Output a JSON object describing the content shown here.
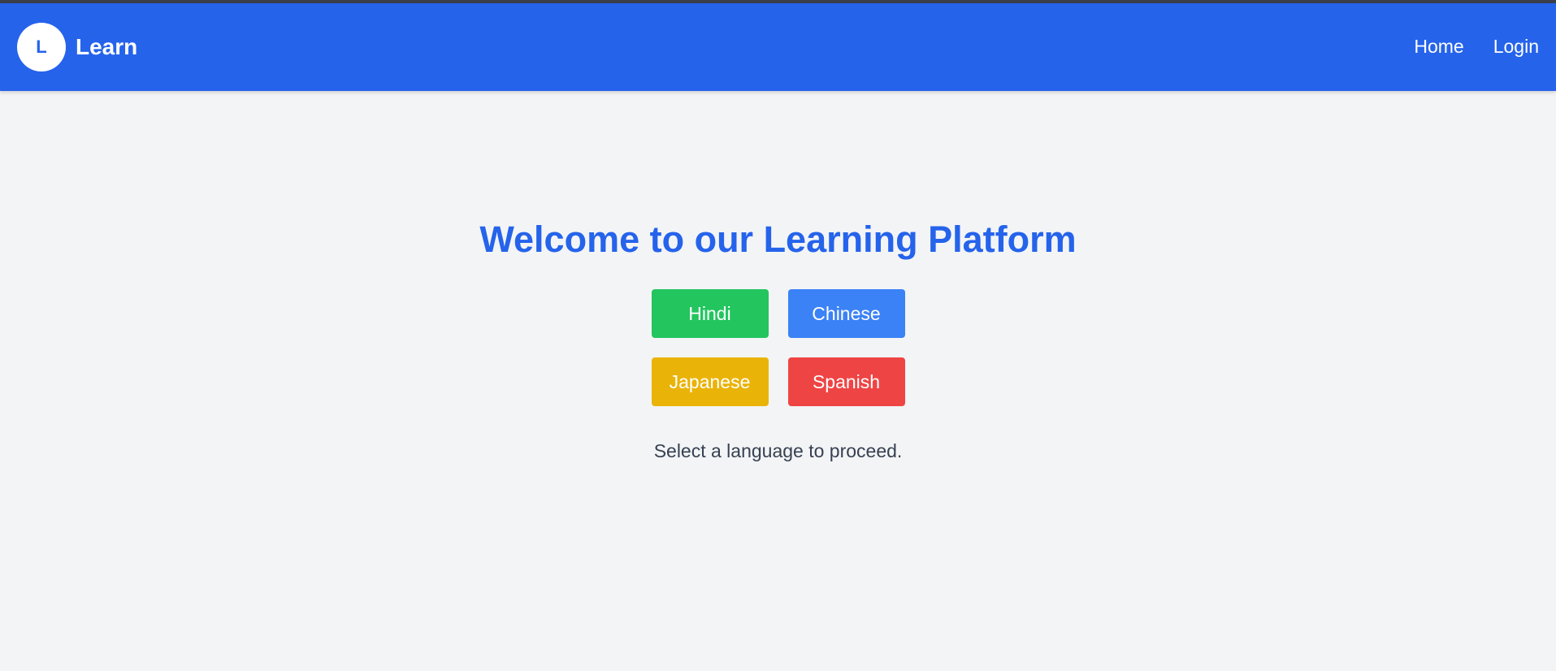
{
  "header": {
    "logo_letter": "L",
    "brand_name": "Learn",
    "nav": [
      {
        "label": "Home"
      },
      {
        "label": "Login"
      }
    ]
  },
  "main": {
    "title": "Welcome to our Learning Platform",
    "languages": [
      {
        "label": "Hindi",
        "color": "#22c55e"
      },
      {
        "label": "Chinese",
        "color": "#3b82f6"
      },
      {
        "label": "Japanese",
        "color": "#eab308"
      },
      {
        "label": "Spanish",
        "color": "#ef4444"
      }
    ],
    "prompt": "Select a language to proceed."
  },
  "colors": {
    "primary": "#2563eb",
    "background": "#f3f4f6"
  }
}
